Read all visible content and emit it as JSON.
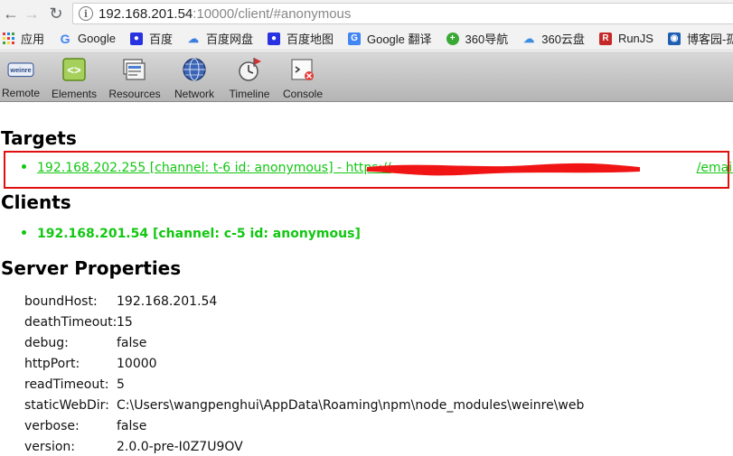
{
  "browser": {
    "url_host": "192.168.201.54",
    "url_path": ":10000/client/#anonymous"
  },
  "bookmarks": [
    {
      "label": "应用",
      "icon": "apps-grid-icon"
    },
    {
      "label": "Google",
      "icon": "google-icon"
    },
    {
      "label": "百度",
      "icon": "baidu-paw-icon"
    },
    {
      "label": "百度网盘",
      "icon": "baidu-cloud-icon"
    },
    {
      "label": "百度地图",
      "icon": "baidu-map-icon"
    },
    {
      "label": "Google 翻译",
      "icon": "google-translate-icon"
    },
    {
      "label": "360导航",
      "icon": "360-nav-icon"
    },
    {
      "label": "360云盘",
      "icon": "360-cloud-icon"
    },
    {
      "label": "RunJS",
      "icon": "runjs-icon"
    },
    {
      "label": "博客园-孤舟蓑笠",
      "icon": "cnblogs-icon"
    }
  ],
  "toolbar": {
    "remote": "Remote",
    "elements": "Elements",
    "resources": "Resources",
    "network": "Network",
    "timeline": "Timeline",
    "console": "Console"
  },
  "sections": {
    "targets": "Targets",
    "clients": "Clients",
    "server_properties": "Server Properties"
  },
  "targets": [
    {
      "text_start": "192.168.202.255 [channel: t-6 id: anonymous] - https://",
      "text_end": "/email.html"
    }
  ],
  "clients": [
    {
      "text": "192.168.201.54 [channel: c-5 id: anonymous]"
    }
  ],
  "server_properties": [
    {
      "key": "boundHost:",
      "value": "192.168.201.54"
    },
    {
      "key": "deathTimeout:",
      "value": "15"
    },
    {
      "key": "debug:",
      "value": "false"
    },
    {
      "key": "httpPort:",
      "value": "10000"
    },
    {
      "key": "readTimeout:",
      "value": "5"
    },
    {
      "key": "staticWebDir:",
      "value": "C:\\Users\\wangpenghui\\AppData\\Roaming\\npm\\node_modules\\weinre\\web"
    },
    {
      "key": "verbose:",
      "value": "false"
    },
    {
      "key": "version:",
      "value": "2.0.0-pre-I0Z7U9OV"
    }
  ],
  "colors": {
    "link_green": "#12c712",
    "highlight_red": "#e01010"
  }
}
